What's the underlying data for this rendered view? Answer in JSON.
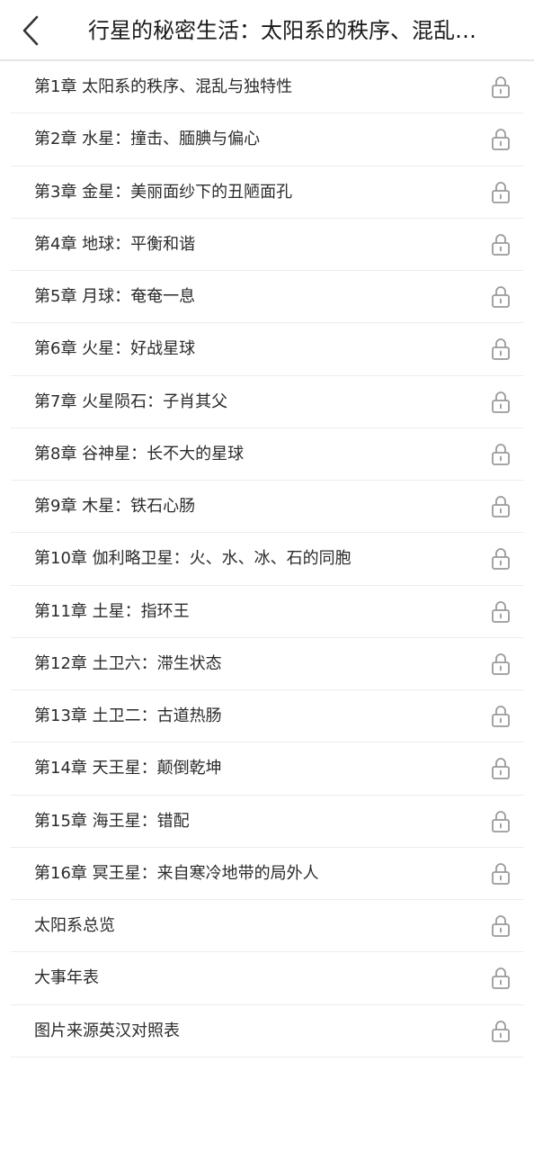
{
  "header": {
    "back_icon": "chevron-left-icon",
    "title": "行星的秘密生活：太阳系的秩序、混乱与独特性"
  },
  "chapters": [
    {
      "label": "第1章 太阳系的秩序、混乱与独特性",
      "locked": true
    },
    {
      "label": "第2章 水星：撞击、腼腆与偏心",
      "locked": true
    },
    {
      "label": "第3章 金星：美丽面纱下的丑陋面孔",
      "locked": true
    },
    {
      "label": "第4章 地球：平衡和谐",
      "locked": true
    },
    {
      "label": "第5章 月球：奄奄一息",
      "locked": true
    },
    {
      "label": "第6章 火星：好战星球",
      "locked": true
    },
    {
      "label": "第7章 火星陨石：子肖其父",
      "locked": true
    },
    {
      "label": "第8章 谷神星：长不大的星球",
      "locked": true
    },
    {
      "label": "第9章 木星：铁石心肠",
      "locked": true
    },
    {
      "label": "第10章 伽利略卫星：火、水、冰、石的同胞",
      "locked": true
    },
    {
      "label": "第11章 土星：指环王",
      "locked": true
    },
    {
      "label": "第12章 土卫六：滞生状态",
      "locked": true
    },
    {
      "label": "第13章 土卫二：古道热肠",
      "locked": true
    },
    {
      "label": "第14章 天王星：颠倒乾坤",
      "locked": true
    },
    {
      "label": "第15章 海王星：错配",
      "locked": true
    },
    {
      "label": "第16章 冥王星：来自寒冷地带的局外人",
      "locked": true
    },
    {
      "label": "太阳系总览",
      "locked": true
    },
    {
      "label": "大事年表",
      "locked": true
    },
    {
      "label": "图片来源英汉对照表",
      "locked": true
    }
  ],
  "icons": {
    "lock": "lock-icon"
  },
  "colors": {
    "lock": "#9a9a9a",
    "divider": "#ececec",
    "text": "#2b2b2b"
  }
}
